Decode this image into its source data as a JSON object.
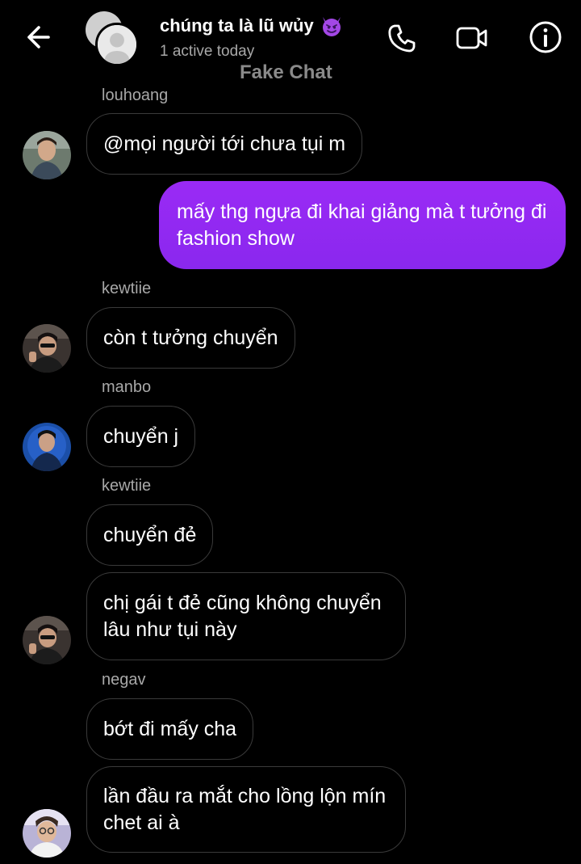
{
  "header": {
    "title": "chúng ta là lũ wủy",
    "status": "1 active today",
    "watermark": "Fake Chat",
    "icons": [
      "back-arrow-icon",
      "group-avatar",
      "devil-emoji-icon",
      "phone-icon",
      "video-camera-icon",
      "info-icon"
    ]
  },
  "messages": [
    {
      "sender": "louhoang",
      "text": "@mọi người tới chưa tụi m"
    },
    {
      "sender": "me",
      "text": "mấy thg ngựa đi khai giảng mà t tưởng đi fashion show"
    },
    {
      "sender": "kewtiie",
      "text": "còn t tưởng chuyển"
    },
    {
      "sender": "manbo",
      "text": "chuyển j"
    },
    {
      "sender": "kewtiie",
      "text": "chuyển đẻ"
    },
    {
      "sender": "kewtiie",
      "text": "chị gái t đẻ cũng không chuyển lâu như tụi này"
    },
    {
      "sender": "negav",
      "text": "bớt đi mấy cha"
    },
    {
      "sender": "negav",
      "text": "lần đầu ra mắt cho lồng lộn mín chet ai à"
    }
  ],
  "colors": {
    "background": "#000000",
    "outgoing_bubble": "#8a28ee",
    "incoming_border": "#3a3a3a",
    "secondary_text": "#a8a8a8"
  }
}
